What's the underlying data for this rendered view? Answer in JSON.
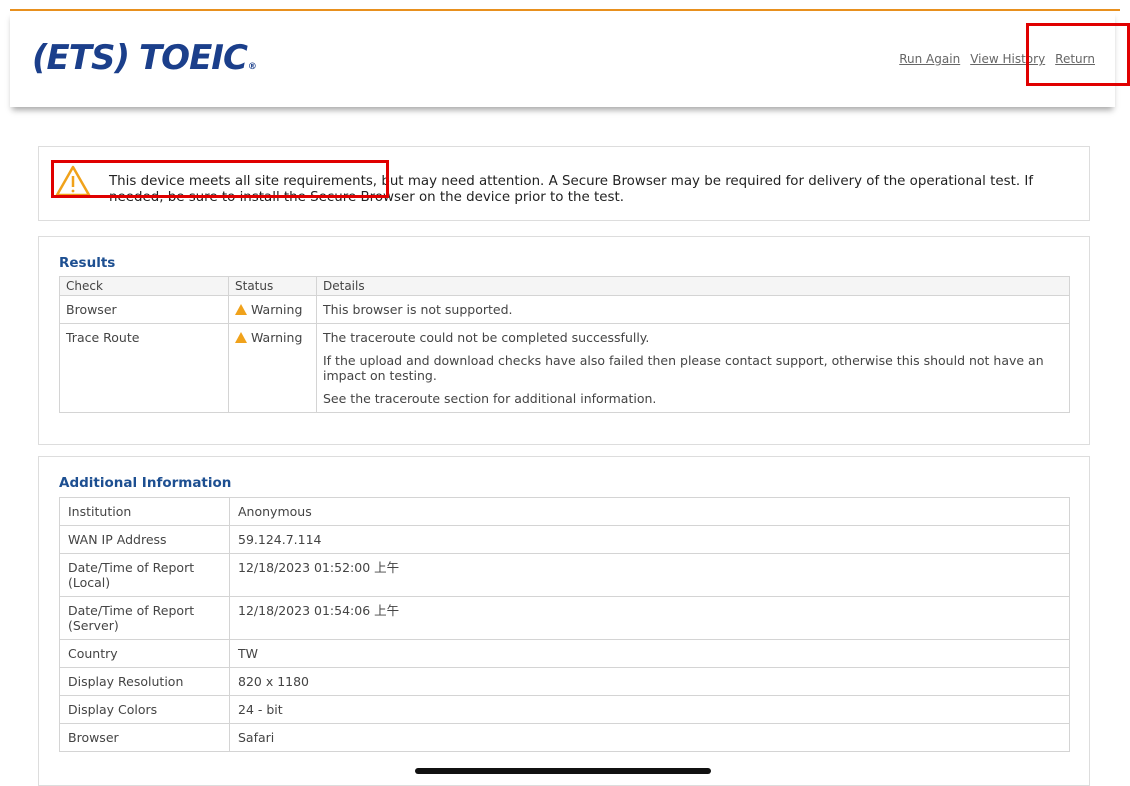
{
  "brand": {
    "ets": "(ETS)",
    "toeic": "TOEIC",
    "reg": "®"
  },
  "nav": {
    "run_again": "Run Again",
    "view_history": "View History",
    "return": "Return"
  },
  "alert": {
    "icon": "warning-triangle-icon",
    "message": "This device meets all site requirements, but may need attention. A Secure Browser may be required for delivery of the operational test. If needed, be sure to install the Secure Browser on the device prior to the test."
  },
  "results": {
    "title": "Results",
    "columns": [
      "Check",
      "Status",
      "Details"
    ],
    "rows": [
      {
        "check": "Browser",
        "status": "Warning",
        "details": [
          "This browser is not supported."
        ]
      },
      {
        "check": "Trace Route",
        "status": "Warning",
        "details": [
          "The traceroute could not be completed successfully.",
          "If the upload and download checks have also failed then please contact support, otherwise this should not have an impact on testing.",
          "See the traceroute section for additional information."
        ]
      }
    ]
  },
  "additional": {
    "title": "Additional Information",
    "rows": [
      {
        "label": "Institution",
        "value": "Anonymous"
      },
      {
        "label": "WAN IP Address",
        "value": "59.124.7.114"
      },
      {
        "label": "Date/Time of Report (Local)",
        "value": "12/18/2023 01:52:00 上午"
      },
      {
        "label": "Date/Time of Report (Server)",
        "value": "12/18/2023 01:54:06 上午"
      },
      {
        "label": "Country",
        "value": "TW"
      },
      {
        "label": "Display Resolution",
        "value": "820 x 1180"
      },
      {
        "label": "Display Colors",
        "value": "24 - bit"
      },
      {
        "label": "Browser",
        "value": "Safari"
      }
    ]
  },
  "colors": {
    "accent": "#e8901e",
    "brand_blue": "#1b3f8b",
    "heading_blue": "#1d4f91",
    "warning": "#f0a21b",
    "highlight_red": "#e00000"
  }
}
